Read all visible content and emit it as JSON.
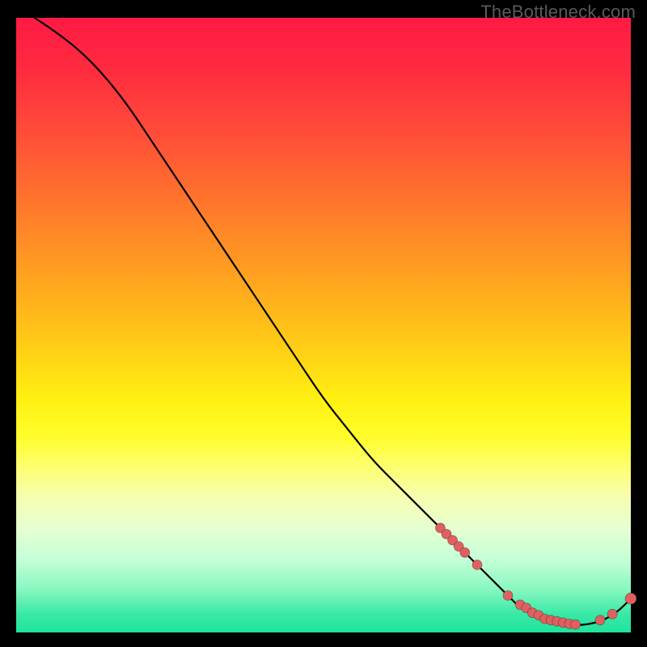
{
  "watermark": "TheBottleneck.com",
  "colors": {
    "background": "#000000",
    "curve": "#000000",
    "point": "#e06060"
  },
  "chart_data": {
    "type": "line",
    "title": "",
    "xlabel": "",
    "ylabel": "",
    "xlim": [
      0,
      100
    ],
    "ylim": [
      0,
      100
    ],
    "grid": false,
    "legend": false,
    "x": [
      3,
      6,
      10,
      14,
      18,
      22,
      26,
      30,
      34,
      38,
      42,
      46,
      50,
      54,
      58,
      62,
      66,
      70,
      73,
      76,
      78,
      80,
      82,
      84,
      86,
      88,
      90,
      92,
      94,
      96,
      98,
      100
    ],
    "values": [
      100,
      98,
      95,
      91,
      86,
      80,
      74,
      68,
      62,
      56,
      50,
      44,
      38,
      33,
      28,
      24,
      20,
      16,
      13,
      10,
      8,
      6,
      4,
      3,
      2,
      1.5,
      1.2,
      1.2,
      1.5,
      2.2,
      3.5,
      5.5
    ],
    "scatter_points_x": [
      69,
      70,
      71,
      72,
      73,
      75,
      80,
      82,
      83,
      84,
      85,
      86,
      87,
      88,
      89,
      90,
      91,
      95,
      97,
      100
    ],
    "scatter_points_y": [
      17,
      16,
      15,
      14,
      13,
      11,
      6,
      4.5,
      4,
      3.2,
      2.8,
      2.2,
      2,
      1.8,
      1.6,
      1.4,
      1.3,
      2,
      3,
      5.5
    ]
  }
}
